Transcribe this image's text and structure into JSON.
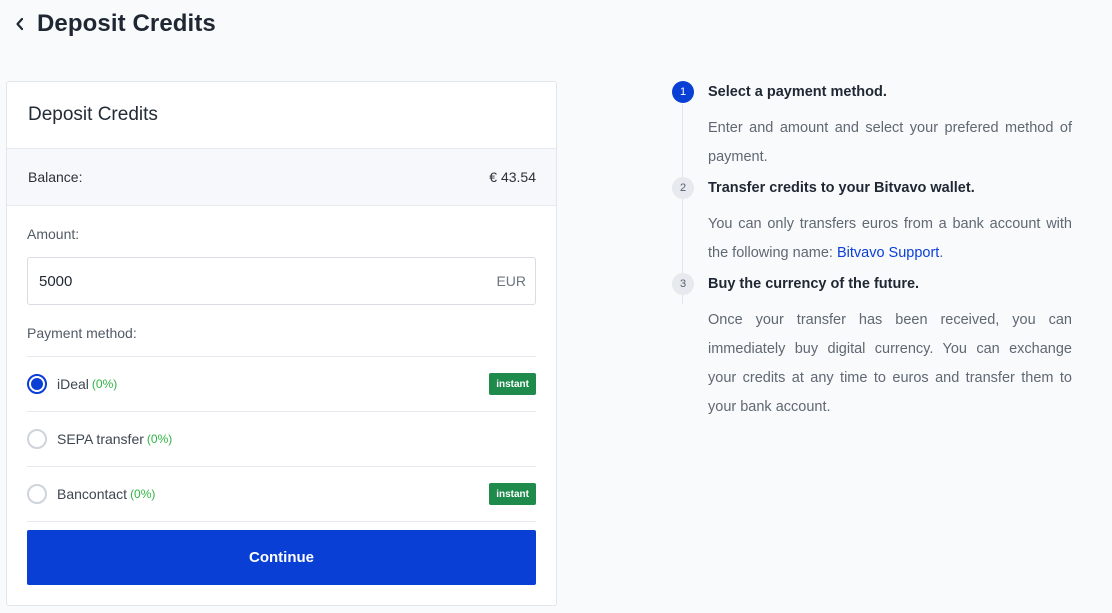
{
  "header": {
    "title": "Deposit Credits"
  },
  "card": {
    "title": "Deposit Credits",
    "balance_label": "Balance:",
    "balance_value": "€ 43.54",
    "amount_label": "Amount:",
    "amount_value": "5000",
    "amount_currency": "EUR",
    "payment_label": "Payment method:",
    "methods": [
      {
        "name": "iDeal",
        "fee": "(0%)",
        "badge": "instant",
        "selected": true
      },
      {
        "name": "SEPA transfer",
        "fee": "(0%)",
        "badge": "",
        "selected": false
      },
      {
        "name": "Bancontact",
        "fee": "(0%)",
        "badge": "instant",
        "selected": false
      }
    ],
    "continue_label": "Continue"
  },
  "steps": [
    {
      "number": "1",
      "title": "Select a payment method.",
      "text": "Enter and amount and select your prefered method of payment."
    },
    {
      "number": "2",
      "title": "Transfer credits to your Bitvavo wallet.",
      "text_before": "You can only transfers euros from a bank account with the following name: ",
      "link": "Bitvavo Support",
      "text_after": "."
    },
    {
      "number": "3",
      "title": "Buy the currency of the future.",
      "text": "Once your transfer has been received, you can immediately buy digital currency. You can exchange your credits at any time to euros and transfer them to your bank account."
    }
  ],
  "colors": {
    "accent": "#0a3fd6",
    "badge": "#1e8a4c",
    "fee": "#2fb344"
  },
  "icons": {
    "back": "chevron-left-icon"
  }
}
